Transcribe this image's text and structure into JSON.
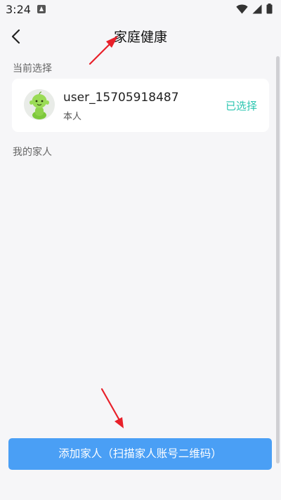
{
  "status_bar": {
    "time": "3:24",
    "icons": [
      "notification-a-icon",
      "wifi-icon",
      "signal-icon",
      "battery-icon"
    ]
  },
  "header": {
    "title": "家庭健康",
    "back_icon": "back-chevron-icon"
  },
  "current_section": {
    "label": "当前选择",
    "card": {
      "username": "user_15705918487",
      "relation": "本人",
      "status": "已选择",
      "status_color": "#2bc6b0"
    }
  },
  "family_section": {
    "label": "我的家人",
    "members": []
  },
  "footer": {
    "add_button_label": "添加家人（扫描家人账号二维码）",
    "button_color": "#4a9ff5"
  },
  "annotations": {
    "arrow_color": "#e8202a"
  }
}
